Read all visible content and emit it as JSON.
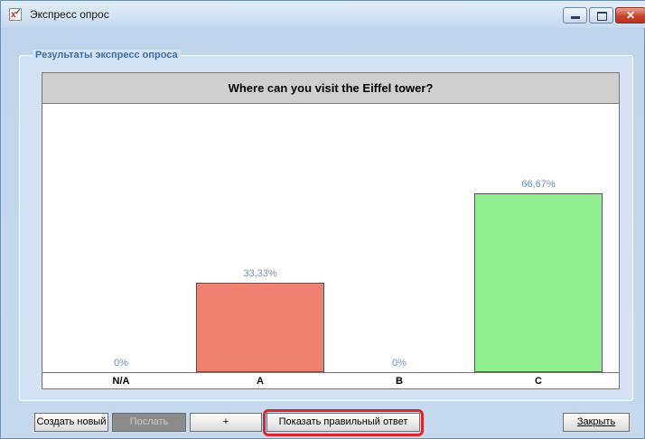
{
  "window": {
    "title": "Экспресс опрос",
    "icon": "app-check-icon",
    "controls": [
      "minimize-icon",
      "maximize-icon",
      "close-icon"
    ]
  },
  "group": {
    "title": "Результаты экспресс опроса"
  },
  "chart_data": {
    "type": "bar",
    "title": "Where can you visit the Eiffel tower?",
    "categories": [
      "N/A",
      "A",
      "B",
      "C"
    ],
    "values": [
      0,
      33.33,
      0,
      66.67
    ],
    "value_labels": [
      "0%",
      "33,33%",
      "0%",
      "66,67%"
    ],
    "colors": [
      "#f08070",
      "#f08070",
      "#90ee90",
      "#90ee90"
    ],
    "ylim": [
      0,
      100
    ],
    "grid": false
  },
  "buttons": {
    "create_new": "Создать новый",
    "send": "Послать",
    "plus": "+",
    "show_answer": "Показать правильный ответ",
    "close": "Закрыть"
  },
  "colors": {
    "accent": "#3d6fae",
    "highlight": "#d9272e",
    "bar_wrong": "#f08070",
    "bar_correct": "#90ee90"
  }
}
